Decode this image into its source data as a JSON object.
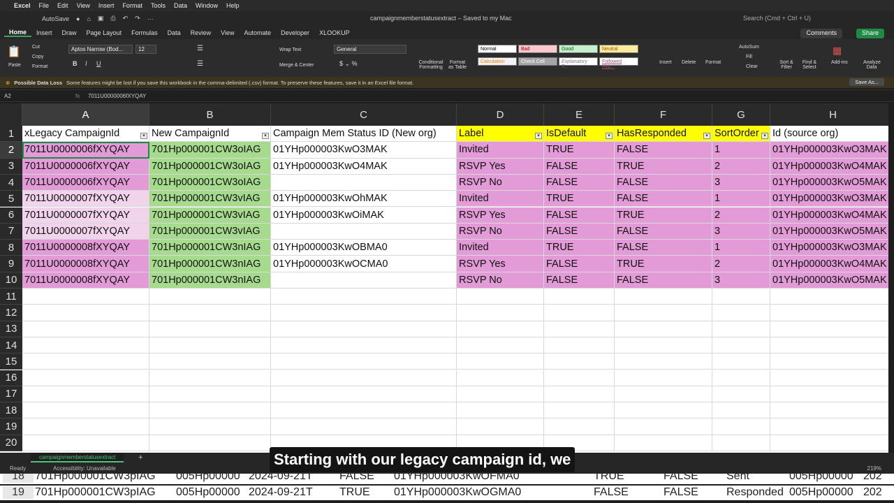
{
  "menubar": {
    "app": "Excel",
    "items": [
      "File",
      "Edit",
      "View",
      "Insert",
      "Format",
      "Tools",
      "Data",
      "Window",
      "Help"
    ]
  },
  "titlebar": {
    "autosave": "AutoSave",
    "doc_title": "campaignmemberstatusextract – Saved to my Mac",
    "search": "Search (Cmd + Ctrl + U)"
  },
  "ribbon_tabs": [
    "Home",
    "Insert",
    "Draw",
    "Page Layout",
    "Formulas",
    "Data",
    "Review",
    "View",
    "Automate",
    "Developer",
    "XLOOKUP"
  ],
  "ribbon": {
    "paste": "Paste",
    "cut": "Cut",
    "copy": "Copy",
    "format": "Format",
    "font": "Aptos Narrow (Bod...",
    "font_size": "12",
    "wrap_text": "Wrap Text",
    "merge_center": "Merge & Center",
    "number_format": "General",
    "conditional": "Conditional Formatting",
    "format_table": "Format as Table",
    "styles": [
      "Normal",
      "Bad",
      "Good",
      "Neutral",
      "Calculation",
      "Check Cell",
      "Explanatory T...",
      "Followed Hyp..."
    ],
    "insert": "Insert",
    "delete": "Delete",
    "format2": "Format",
    "autosum": "AutoSum",
    "fill": "Fill",
    "clear": "Clear",
    "sort_filter": "Sort & Filter",
    "find_select": "Find & Select",
    "addins": "Add-ins",
    "analyze": "Analyze Data",
    "comments": "Comments",
    "share": "Share"
  },
  "infobar": {
    "title": "Possible Data Loss",
    "message": "Some features might be lost if you save this workbook in the comma-delimited (.csv) format. To preserve these features, save it in an Excel file format.",
    "save_as": "Save As..."
  },
  "formula": {
    "namebox": "A2",
    "fx": "fx",
    "value": "7011U0000006fXYQAY"
  },
  "columns": [
    "A",
    "B",
    "C",
    "D",
    "E",
    "F",
    "G",
    "H"
  ],
  "header_row": [
    "xLegacy CampaignId",
    "New CampaignId",
    "Campaign Mem Status ID (New org)",
    "Label",
    "IsDefault",
    "HasResponded",
    "SortOrder",
    "Id (source org)"
  ],
  "rows": [
    [
      "7011U0000006fXYQAY",
      "701Hp000001CW3oIAG",
      "01YHp000003KwO3MAK",
      "Invited",
      "TRUE",
      "FALSE",
      "1",
      "01YHp000003KwO3MAK"
    ],
    [
      "7011U0000006fXYQAY",
      "701Hp000001CW3oIAG",
      "01YHp000003KwO4MAK",
      "RSVP Yes",
      "FALSE",
      "TRUE",
      "2",
      "01YHp000003KwO4MAK"
    ],
    [
      "7011U0000006fXYQAY",
      "701Hp000001CW3oIAG",
      "",
      "RSVP No",
      "FALSE",
      "FALSE",
      "3",
      "01YHp000003KwO5MAK"
    ],
    [
      "7011U0000007fXYQAY",
      "701Hp000001CW3vIAG",
      "01YHp000003KwOhMAK",
      "Invited",
      "TRUE",
      "FALSE",
      "1",
      "01YHp000003KwO3MAK"
    ],
    [
      "7011U0000007fXYQAY",
      "701Hp000001CW3vIAG",
      "01YHp000003KwOiMAK",
      "RSVP Yes",
      "FALSE",
      "TRUE",
      "2",
      "01YHp000003KwO4MAK"
    ],
    [
      "7011U0000007fXYQAY",
      "701Hp000001CW3vIAG",
      "",
      "RSVP No",
      "FALSE",
      "FALSE",
      "3",
      "01YHp000003KwO5MAK"
    ],
    [
      "7011U0000008fXYQAY",
      "701Hp000001CW3nIAG",
      "01YHp000003KwOBMA0",
      "Invited",
      "TRUE",
      "FALSE",
      "1",
      "01YHp000003KwO3MAK"
    ],
    [
      "7011U0000008fXYQAY",
      "701Hp000001CW3nIAG",
      "01YHp000003KwOCMA0",
      "RSVP Yes",
      "FALSE",
      "TRUE",
      "2",
      "01YHp000003KwO4MAK"
    ],
    [
      "7011U0000008fXYQAY",
      "701Hp000001CW3nIAG",
      "",
      "RSVP No",
      "FALSE",
      "FALSE",
      "3",
      "01YHp000003KwO5MAK"
    ]
  ],
  "row_numbers": [
    "1",
    "2",
    "3",
    "4",
    "5",
    "6",
    "7",
    "8",
    "9",
    "10",
    "11",
    "12",
    "13",
    "14",
    "15",
    "16",
    "17",
    "18",
    "19",
    "20"
  ],
  "colors": {
    "pink": "#e29bd6",
    "light_pink": "#f2d3ec",
    "green": "#a6db8d",
    "yellow": "#ffff00",
    "selection": "#1e8a46"
  },
  "sheet_tab": "campaignmemberstatusextract",
  "status": {
    "ready": "Ready",
    "accessibility": "Accessibility: Unavailable",
    "zoom": "219%"
  },
  "caption": "Starting with our legacy campaign id, we",
  "bg_rows": [
    [
      "18",
      "701Hp000001CW3pIAG",
      "005Hp00000",
      "2024-09-21T",
      "FALSE",
      "01YHp000003KwOFMA0",
      "TRUE",
      "FALSE",
      "Sent",
      "005Hp00000",
      "202"
    ],
    [
      "19",
      "701Hp000001CW3pIAG",
      "005Hp00000",
      "2024-09-21T",
      "TRUE",
      "01YHp000003KwOGMA0",
      "FALSE",
      "FALSE",
      "Responded",
      "005Hp00000",
      "202"
    ]
  ]
}
